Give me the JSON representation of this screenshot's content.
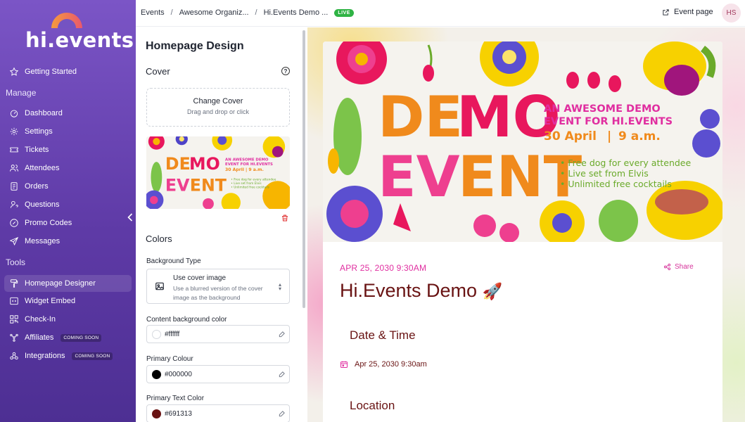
{
  "logo": {
    "text": "hi.events"
  },
  "sidebar": {
    "getting_started": "Getting Started",
    "manage_heading": "Manage",
    "manage_items": [
      {
        "label": "Dashboard",
        "icon": "dashboard-icon"
      },
      {
        "label": "Settings",
        "icon": "gear-icon"
      },
      {
        "label": "Tickets",
        "icon": "ticket-icon"
      },
      {
        "label": "Attendees",
        "icon": "users-icon"
      },
      {
        "label": "Orders",
        "icon": "orders-icon"
      },
      {
        "label": "Questions",
        "icon": "question-user-icon"
      },
      {
        "label": "Promo Codes",
        "icon": "discount-icon"
      },
      {
        "label": "Messages",
        "icon": "send-icon"
      }
    ],
    "tools_heading": "Tools",
    "tools_items": [
      {
        "label": "Homepage Designer",
        "icon": "paint-icon",
        "active": true
      },
      {
        "label": "Widget Embed",
        "icon": "embed-icon"
      },
      {
        "label": "Check-In",
        "icon": "qr-icon"
      },
      {
        "label": "Affiliates",
        "icon": "affiliate-icon",
        "badge": "COMING SOON"
      },
      {
        "label": "Integrations",
        "icon": "integrations-icon",
        "badge": "COMING SOON"
      }
    ]
  },
  "topbar": {
    "breadcrumbs": [
      "Events",
      "Awesome Organiz...",
      "Hi.Events Demo ..."
    ],
    "live_badge": "LIVE",
    "event_page_label": "Event page",
    "avatar_initials": "HS"
  },
  "designer": {
    "title": "Homepage Design",
    "cover_section": "Cover",
    "change_cover": "Change Cover",
    "drag_hint": "Drag and drop or click",
    "colors_section": "Colors",
    "background_type_label": "Background Type",
    "background_type_value": "Use cover image",
    "background_type_desc": "Use a blurred version of the cover image as the background",
    "content_bg_label": "Content background color",
    "content_bg_value": "#ffffff",
    "primary_colour_label": "Primary Colour",
    "primary_colour_value": "#000000",
    "primary_text_label": "Primary Text Color",
    "primary_text_value": "#691313"
  },
  "cover_art": {
    "line1": "DEMO",
    "line2": "EVENT",
    "headline1": "AN AWESOME DEMO",
    "headline2": "EVENT FOR HI.EVENTS",
    "date_line": "30 April",
    "time_line": "9 a.m.",
    "bullets": [
      "• Free dog for every attendee",
      "• Live set from Elvis",
      "• Unlimited free cocktails"
    ]
  },
  "preview": {
    "date": "APR 25, 2030 9:30AM",
    "share": "Share",
    "title": "Hi.Events Demo",
    "title_emoji": "🚀",
    "date_time_heading": "Date & Time",
    "date_time_value": "Apr 25, 2030 9:30am",
    "location_heading": "Location"
  },
  "colors": {
    "accent_pink": "#e02ea0",
    "primary_text": "#691313",
    "sidebar_purple": "#6c48b8",
    "live_green": "#2fb344"
  }
}
